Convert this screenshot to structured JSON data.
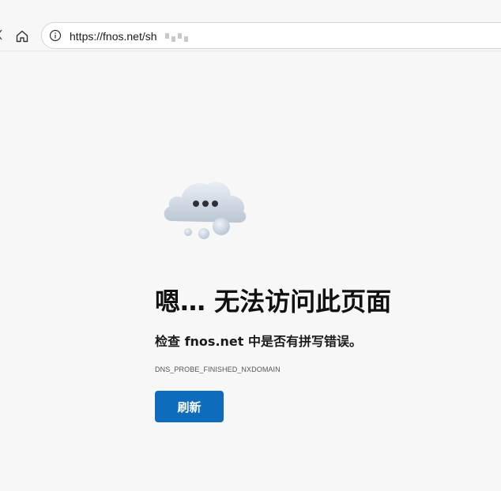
{
  "browser": {
    "address_bar": {
      "url": "https://fnos.net/sh"
    },
    "icons": {
      "home": "home-icon",
      "info": "info-icon"
    }
  },
  "error_page": {
    "illustration": "cloud-thinking-icon",
    "title": "嗯… 无法访问此页面",
    "message": "检查 fnos.net 中是否有拼写错误。",
    "error_code": "DNS_PROBE_FINISHED_NXDOMAIN",
    "refresh_label": "刷新"
  },
  "colors": {
    "background": "#f7f7f7",
    "accent": "#0f6cbd",
    "text": "#111111"
  }
}
